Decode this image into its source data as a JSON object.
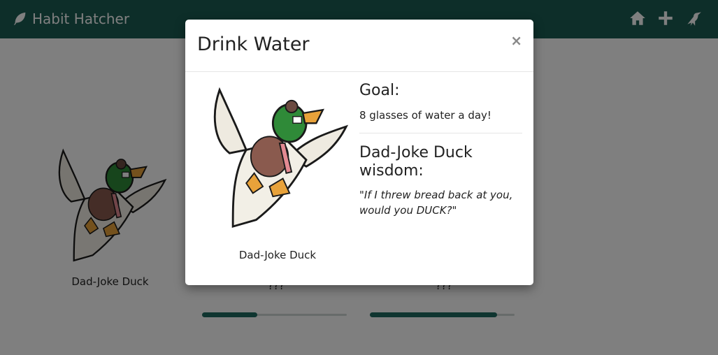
{
  "navbar": {
    "brand": "Habit Hatcher",
    "icons": [
      "home-icon",
      "plus-icon",
      "crow-icon"
    ],
    "bg_color": "#1a5c53"
  },
  "cards": [
    {
      "name": "Dad-Joke Duck"
    },
    {
      "name": "???",
      "progress": 0.38
    },
    {
      "name": "???",
      "progress": 0.88
    }
  ],
  "modal": {
    "title": "Drink Water",
    "close": "×",
    "duck_name": "Dad-Joke Duck",
    "goal_heading": "Goal:",
    "goal_text": "8 glasses of water a day!",
    "wisdom_heading": "Dad-Joke Duck wisdom:",
    "quote": "\"If I threw bread back at you, would you DUCK?\""
  }
}
